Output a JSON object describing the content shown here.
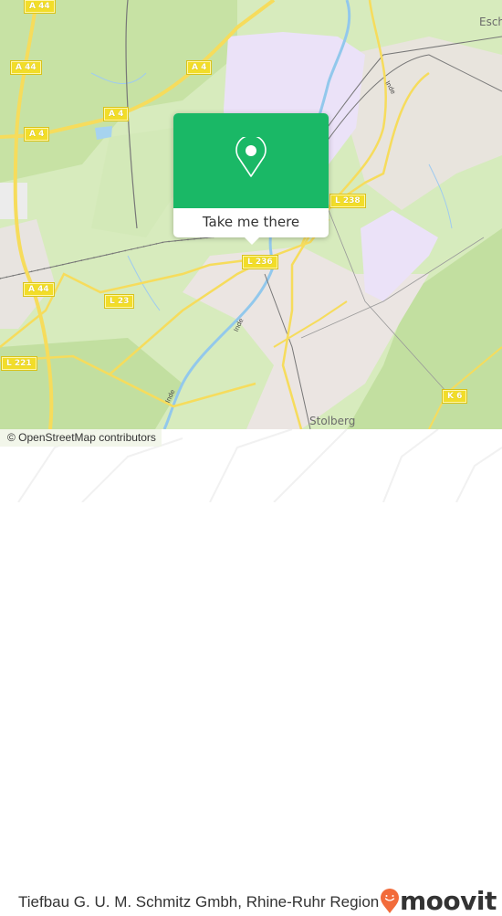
{
  "map": {
    "colors": {
      "background": "#d7ebbd",
      "forest": "#c4e1a0",
      "urban": "#ece6e3",
      "industrial": "#ebe2f7",
      "water": "#a6d3ef",
      "motorway": "#f6dc5c",
      "railway": "#777777"
    },
    "road_shields": [
      {
        "id": "a44-top",
        "label": "A 44"
      },
      {
        "id": "a44-mid",
        "label": "A 44"
      },
      {
        "id": "a4-right",
        "label": "A 4"
      },
      {
        "id": "a4-center",
        "label": "A 4"
      },
      {
        "id": "a4-left",
        "label": "A 4"
      },
      {
        "id": "a44-bottom",
        "label": "A 44"
      },
      {
        "id": "l23",
        "label": "L 23"
      },
      {
        "id": "l221",
        "label": "L 221"
      },
      {
        "id": "l236",
        "label": "L 236"
      },
      {
        "id": "l238",
        "label": "L 238"
      },
      {
        "id": "k6",
        "label": "K 6"
      }
    ],
    "places": [
      {
        "id": "eschweiler",
        "label": "Esch"
      },
      {
        "id": "stolberg",
        "label": "Stolberg"
      }
    ],
    "rivers": [
      {
        "id": "inde-north",
        "label": "Inde"
      },
      {
        "id": "inde-mid",
        "label": "Inde"
      },
      {
        "id": "inde-south",
        "label": "Inde"
      }
    ],
    "popup": {
      "icon": "location-pin-icon",
      "button_label": "Take me there",
      "accent": "#1ab866"
    },
    "attribution": "© OpenStreetMap contributors"
  },
  "footer": {
    "title": "Tiefbau G. U. M. Schmitz Gmbh, Rhine-Ruhr Region",
    "logo_text": "moovit",
    "logo_color": "#f26b3a"
  }
}
